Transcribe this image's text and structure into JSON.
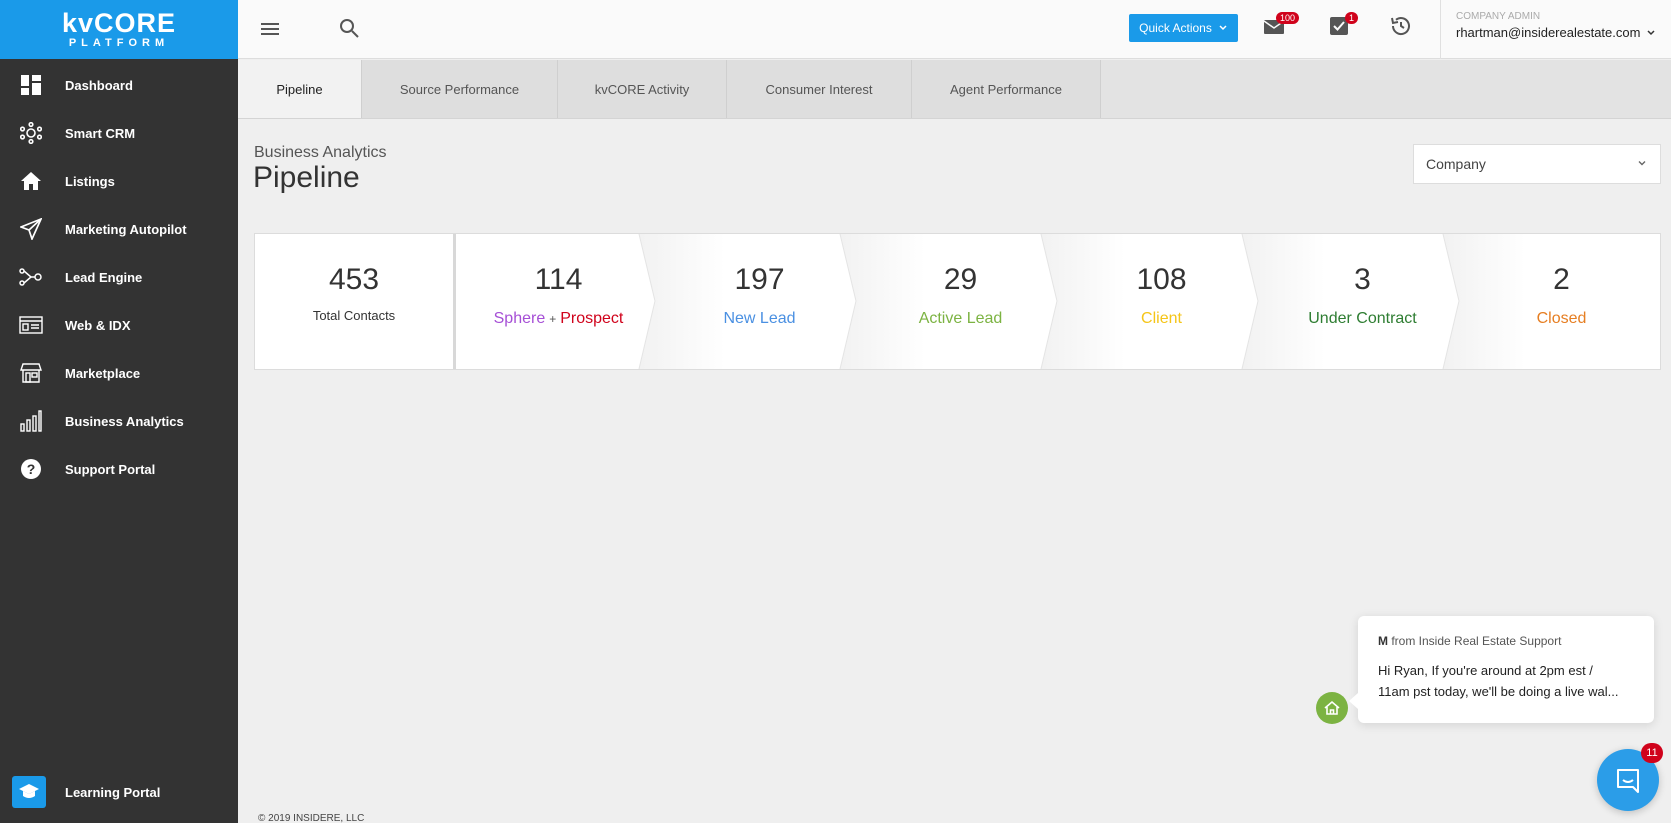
{
  "logo": {
    "main": "kvCORE",
    "sub": "PLATFORM"
  },
  "sidebar": {
    "items": [
      {
        "label": "Dashboard",
        "icon": "dashboard-icon"
      },
      {
        "label": "Smart CRM",
        "icon": "crm-network-icon"
      },
      {
        "label": "Listings",
        "icon": "home-icon"
      },
      {
        "label": "Marketing Autopilot",
        "icon": "paper-plane-icon"
      },
      {
        "label": "Lead Engine",
        "icon": "lead-flow-icon"
      },
      {
        "label": "Web & IDX",
        "icon": "web-idx-icon"
      },
      {
        "label": "Marketplace",
        "icon": "storefront-icon"
      },
      {
        "label": "Business Analytics",
        "icon": "bar-chart-icon"
      },
      {
        "label": "Support Portal",
        "icon": "help-circle-icon"
      }
    ],
    "learning": {
      "label": "Learning Portal",
      "icon": "graduation-cap-icon"
    }
  },
  "topbar": {
    "quick_actions": "Quick Actions",
    "mail_badge": "100",
    "tasks_badge": "1",
    "admin_role": "COMPANY ADMIN",
    "admin_email": "rhartman@insiderealestate.com"
  },
  "tabs": [
    {
      "label": "Pipeline",
      "active": true
    },
    {
      "label": "Source Performance",
      "active": false
    },
    {
      "label": "kvCORE Activity",
      "active": false
    },
    {
      "label": "Consumer Interest",
      "active": false
    },
    {
      "label": "Agent Performance",
      "active": false
    }
  ],
  "page": {
    "subtitle": "Business Analytics",
    "title": "Pipeline",
    "scope_select": "Company"
  },
  "pipeline": {
    "total": {
      "value": "453",
      "label": "Total Contacts"
    },
    "stages": [
      {
        "value": "114",
        "label": "Sphere",
        "label2": "Prospect",
        "plus": "+",
        "color": "#a64fd6",
        "color2": "#d0021b"
      },
      {
        "value": "197",
        "label": "New Lead",
        "color": "#4a90e2"
      },
      {
        "value": "29",
        "label": "Active Lead",
        "color": "#7cb342"
      },
      {
        "value": "108",
        "label": "Client",
        "color": "#f5c518"
      },
      {
        "value": "3",
        "label": "Under Contract",
        "color": "#2e7d32"
      },
      {
        "value": "2",
        "label": "Closed",
        "color": "#e67e22"
      }
    ]
  },
  "footer": {
    "copyright": "© 2019 INSIDERE, LLC"
  },
  "chat": {
    "from_initial": "M",
    "from_text": "from Inside Real Estate Support",
    "message_line1": "Hi Ryan, If you're around at 2pm est /",
    "message_line2": "11am pst today, we'll be doing a live wal...",
    "launcher_badge": "11"
  }
}
